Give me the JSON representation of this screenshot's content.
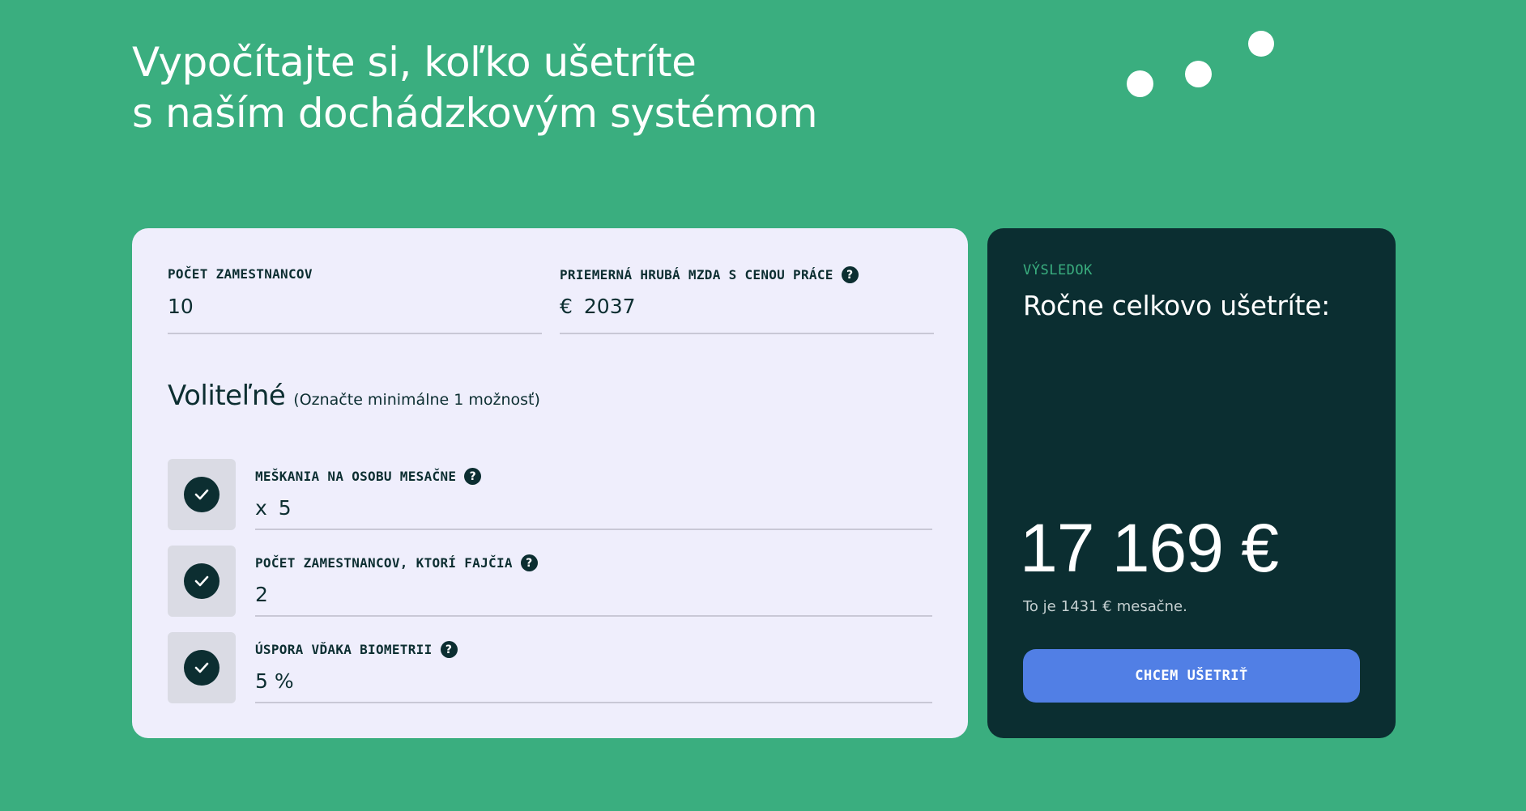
{
  "headline": {
    "line1": "Vypočítajte si, koľko ušetríte",
    "line2": "s naším dochádzkovým systémom"
  },
  "form": {
    "employees": {
      "label": "POČET ZAMESTNANCOV",
      "value": "10"
    },
    "salary": {
      "label": "PRIEMERNÁ HRUBÁ MZDA S CENOU PRÁCE",
      "prefix": "€",
      "value": "2037"
    },
    "optional": {
      "title": "Voliteľné",
      "hint": "(Označte minimálne 1 možnosť)"
    },
    "options": [
      {
        "label": "MEŠKANIA NA OSOBU MESAČNE",
        "prefix": "x",
        "value": "5",
        "checked": true
      },
      {
        "label": "POČET ZAMESTNANCOV, KTORÍ FAJČIA",
        "prefix": "",
        "value": "2",
        "checked": true
      },
      {
        "label": "ÚSPORA VĎAKA BIOMETRII",
        "prefix": "",
        "value": "5 %",
        "checked": true
      }
    ],
    "help_glyph": "?"
  },
  "result": {
    "eyebrow": "VÝSLEDOK",
    "title": "Ročne celkovo ušetríte:",
    "amount": "17 169 €",
    "monthly_prefix": "To je",
    "monthly_value": "1431 €",
    "monthly_suffix": "mesačne.",
    "cta": "CHCEM UŠETRIŤ"
  },
  "colors": {
    "background": "#3aae7f",
    "form_card": "#efeefc",
    "result_card": "#0b2e31",
    "accent": "#3aae7f",
    "button": "#517fe5",
    "dark_text": "#0c2e31"
  }
}
